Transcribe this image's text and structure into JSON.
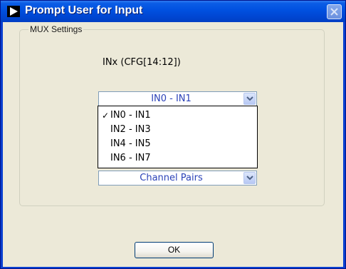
{
  "window": {
    "title": "Prompt User for Input"
  },
  "group": {
    "label": "MUX Settings"
  },
  "inx_field": {
    "label": "INx   (CFG[14:12])",
    "selected_value": "IN0 - IN1",
    "options": [
      {
        "label": "IN0 - IN1",
        "checked": true
      },
      {
        "label": "IN2 - IN3",
        "checked": false
      },
      {
        "label": "IN4 - IN5",
        "checked": false
      },
      {
        "label": "IN6 - IN7",
        "checked": false
      }
    ]
  },
  "mode_field": {
    "selected_value": "Channel Pairs"
  },
  "buttons": {
    "ok_label": "OK"
  },
  "icons": {
    "check_glyph": "✓"
  },
  "colors": {
    "titlebar": "#0050df",
    "dialog_background": "#ece9d8",
    "combo_text": "#2b42b8"
  }
}
